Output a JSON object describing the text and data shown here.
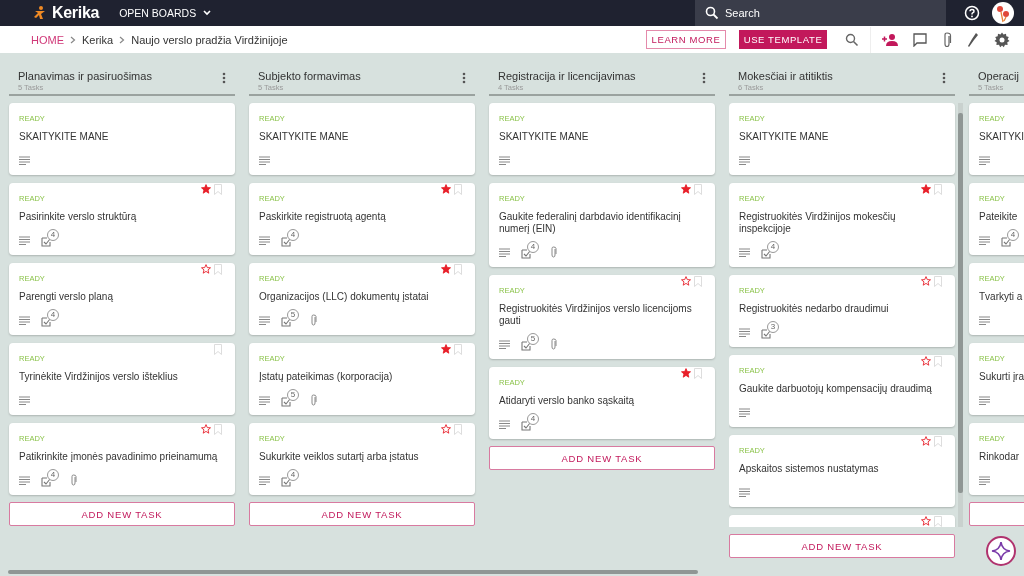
{
  "topbar": {
    "logo": "Kerika",
    "menu": "OPEN BOARDS",
    "search": {
      "placeholder": "Search"
    }
  },
  "breadcrumb": [
    "HOME",
    "Kerika",
    "Naujo verslo pradžia Virdžinijoje"
  ],
  "actions": {
    "learn_more": "LEARN MORE",
    "use_template": "USE TEMPLATE"
  },
  "columns": [
    {
      "title": "Planavimas ir pasiruošimas",
      "count": "5 Tasks",
      "add_label": "ADD NEW TASK",
      "cards": [
        {
          "status": "READY",
          "title": "SKAITYKITE MANE",
          "description": true
        },
        {
          "status": "READY",
          "title": "Pasirinkite verslo struktūrą",
          "starred": true,
          "bookmark": true,
          "description": true,
          "checklist": "4"
        },
        {
          "status": "READY",
          "title": "Parengti verslo planą",
          "starred": false,
          "bookmark": true,
          "description": true,
          "checklist": "4"
        },
        {
          "status": "READY",
          "title": "Tyrinėkite Virdžinijos verslo išteklius",
          "bookmark": true,
          "description": true
        },
        {
          "status": "READY",
          "title": "Patikrinkite įmonės pavadinimo prieinamumą",
          "starred": false,
          "bookmark": true,
          "description": true,
          "checklist": "4",
          "attachment": true
        }
      ]
    },
    {
      "title": "Subjekto formavimas",
      "count": "5 Tasks",
      "add_label": "ADD NEW TASK",
      "cards": [
        {
          "status": "READY",
          "title": "SKAITYKITE MANE",
          "description": true
        },
        {
          "status": "READY",
          "title": "Paskirkite registruotą agentą",
          "starred": true,
          "bookmark": true,
          "description": true,
          "checklist": "4"
        },
        {
          "status": "READY",
          "title": "Organizacijos (LLC) dokumentų įstatai",
          "starred": true,
          "bookmark": true,
          "description": true,
          "checklist": "5",
          "attachment": true
        },
        {
          "status": "READY",
          "title": "Įstatų pateikimas (korporacija)",
          "starred": true,
          "bookmark": true,
          "description": true,
          "checklist": "5",
          "attachment": true
        },
        {
          "status": "READY",
          "title": "Sukurkite veiklos sutartį arba įstatus",
          "starred": false,
          "bookmark": true,
          "description": true,
          "checklist": "4"
        }
      ]
    },
    {
      "title": "Registracija ir licencijavimas",
      "count": "4 Tasks",
      "add_label": "ADD NEW TASK",
      "cards": [
        {
          "status": "READY",
          "title": "SKAITYKITE MANE",
          "description": true
        },
        {
          "status": "READY",
          "title": "Gaukite federalinį darbdavio identifikacinį numerį (EIN)",
          "starred": true,
          "bookmark": true,
          "description": true,
          "checklist": "4",
          "attachment": true
        },
        {
          "status": "READY",
          "title": "Registruokitės Virdžinijos verslo licencijoms gauti",
          "starred": false,
          "bookmark": true,
          "description": true,
          "checklist": "5",
          "attachment": true
        },
        {
          "status": "READY",
          "title": "Atidaryti verslo banko sąskaitą",
          "starred": true,
          "bookmark": true,
          "description": true,
          "checklist": "4"
        }
      ]
    },
    {
      "title": "Mokesčiai ir atitiktis",
      "count": "6 Tasks",
      "add_label": "ADD NEW TASK",
      "scrollable": true,
      "cards": [
        {
          "status": "READY",
          "title": "SKAITYKITE MANE",
          "description": true
        },
        {
          "status": "READY",
          "title": "Registruokitės Virdžinijos mokesčių inspekcijoje",
          "starred": true,
          "bookmark": true,
          "description": true,
          "checklist": "4"
        },
        {
          "status": "READY",
          "title": "Registruokitės nedarbo draudimui",
          "starred": false,
          "bookmark": true,
          "description": true,
          "checklist": "3"
        },
        {
          "status": "READY",
          "title": "Gaukite darbuotojų kompensacijų draudimą",
          "starred": false,
          "bookmark": true,
          "description": true
        },
        {
          "status": "READY",
          "title": "Apskaitos sistemos nustatymas",
          "starred": false,
          "bookmark": true,
          "description": true
        },
        {
          "starred": false,
          "bookmark": true
        }
      ]
    },
    {
      "title": "Operacij",
      "count": "5 Tasks",
      "cards": [
        {
          "status": "READY",
          "title": "SKAITYKI",
          "description": true
        },
        {
          "status": "READY",
          "title": "Pateikite",
          "description": true,
          "checklist": "4"
        },
        {
          "status": "READY",
          "title": "Tvarkyti a",
          "description": true
        },
        {
          "status": "READY",
          "title": "Sukurti įra",
          "description": true
        },
        {
          "status": "READY",
          "title": "Rinkodar",
          "description": true
        }
      ]
    }
  ]
}
